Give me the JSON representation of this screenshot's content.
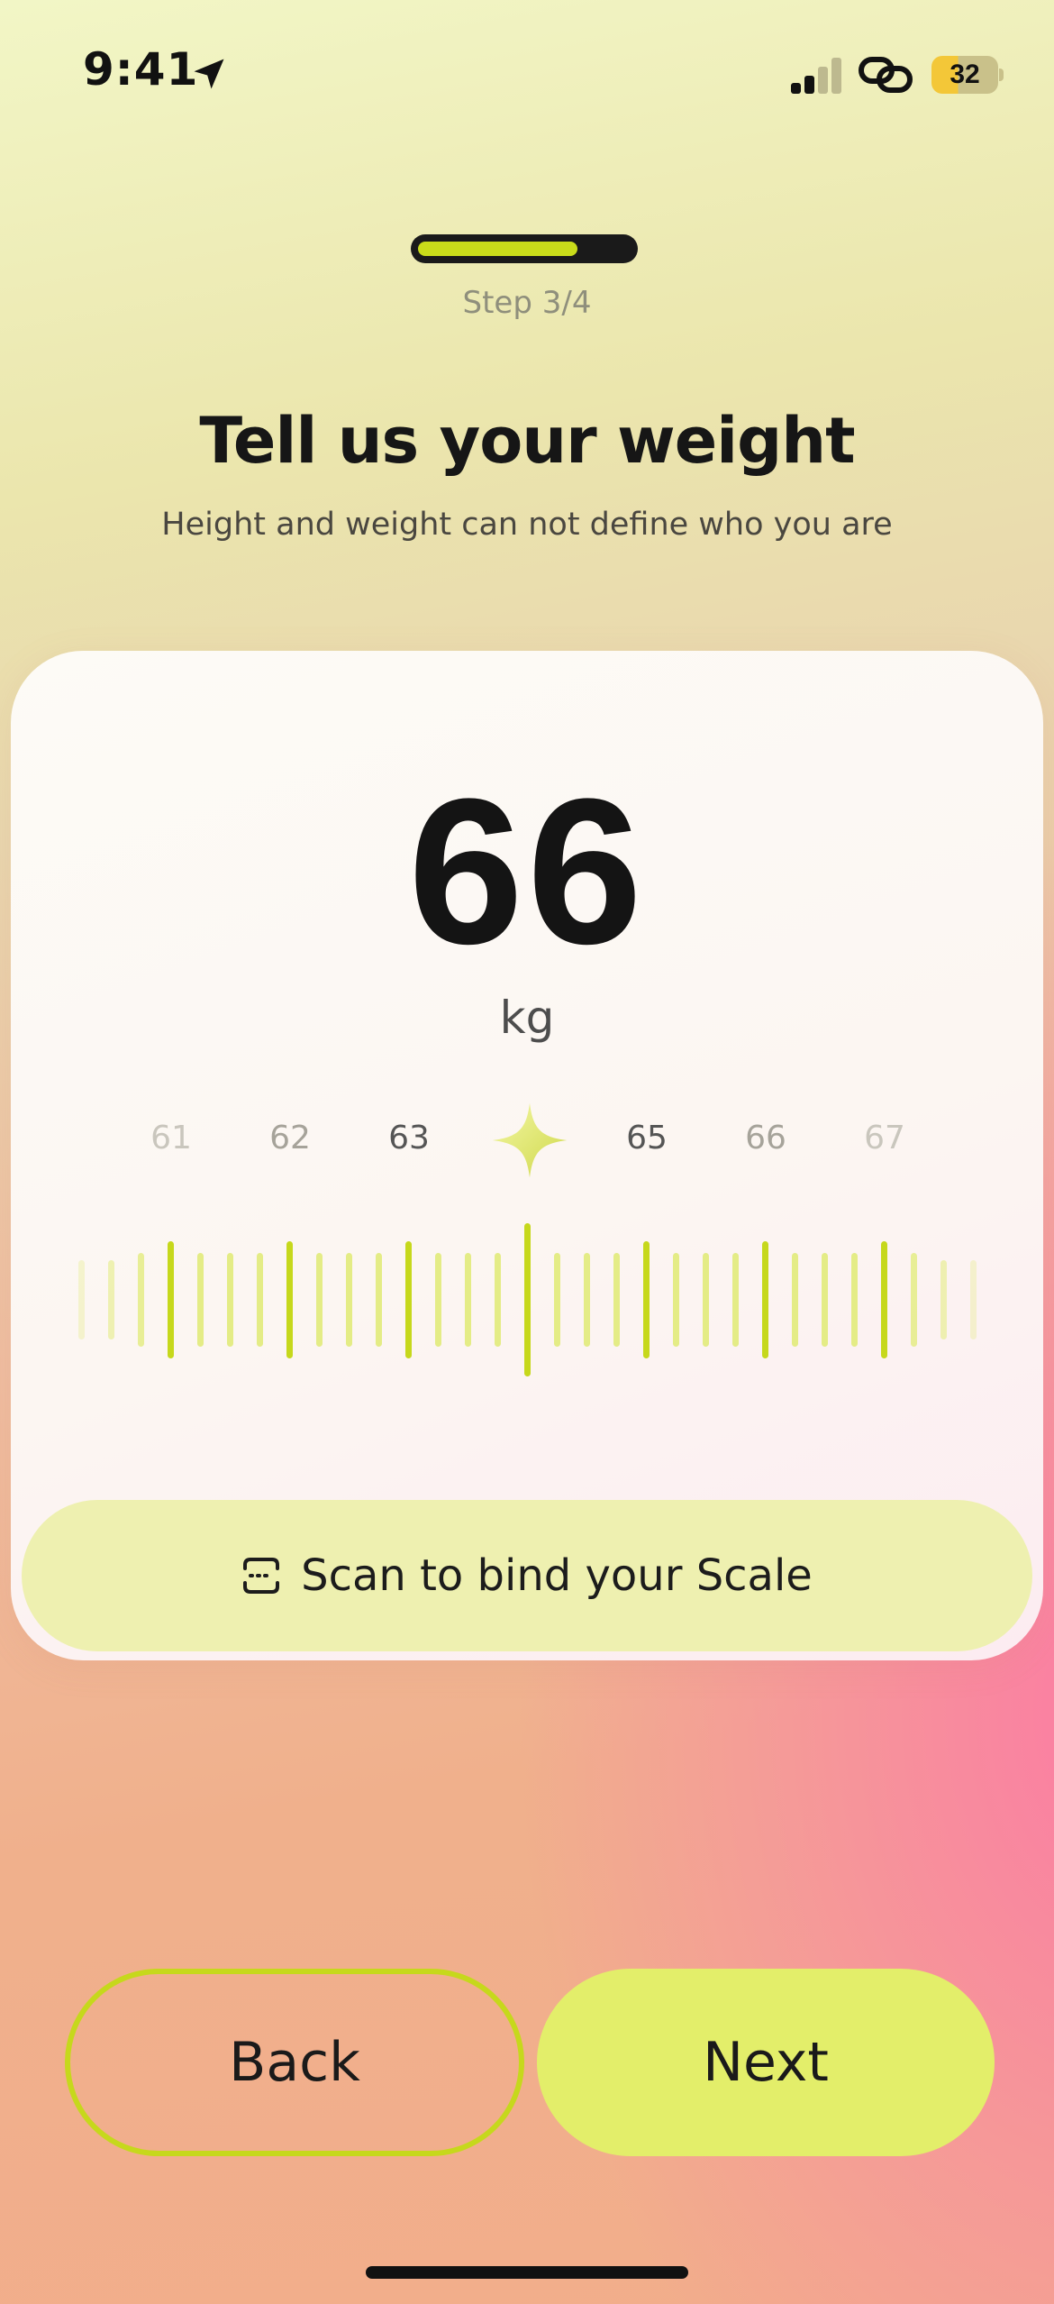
{
  "status_bar": {
    "time": "9:41",
    "battery_level": "32",
    "icons": [
      "location-arrow-icon",
      "cellular-signal-icon",
      "link-icon",
      "battery-icon"
    ]
  },
  "progress": {
    "step_label": "Step 3/4",
    "fraction": 0.75,
    "fill_color": "#c9dc1a"
  },
  "header": {
    "title": "Tell us your weight",
    "subtitle": "Height and weight can not define who you are"
  },
  "weight": {
    "value": "66",
    "unit": "kg",
    "ruler_labels": [
      "61",
      "62",
      "63",
      "65",
      "66",
      "67"
    ],
    "selected_marker": "sparkle-icon"
  },
  "scan": {
    "label": "Scan to bind your Scale",
    "icon": "scan-icon"
  },
  "actions": {
    "back_label": "Back",
    "next_label": "Next"
  },
  "colors": {
    "accent": "#c9dc1a",
    "accent_light": "#e3ee6a",
    "scan_bg": "#eef0b0",
    "text": "#1a1a1a"
  }
}
